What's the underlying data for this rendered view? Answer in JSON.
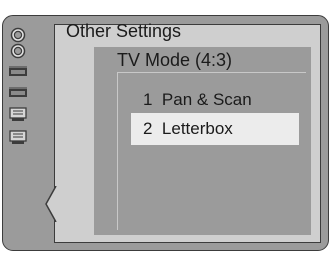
{
  "menu": {
    "title": "Other Settings",
    "submenu_title": "TV Mode (4:3)",
    "options": [
      {
        "number": "1",
        "label": "Pan & Scan",
        "selected": false
      },
      {
        "number": "2",
        "label": "Letterbox",
        "selected": true
      }
    ]
  },
  "sidebar": {
    "icons": [
      "disc-icon",
      "disc-icon",
      "tape-icon",
      "tape-icon",
      "tv-icon",
      "tv-icon"
    ]
  },
  "colors": {
    "frame": "#9b9b9b",
    "panel": "#cfcfcf",
    "selected_row": "#ececec",
    "text": "#1b1b1b"
  }
}
